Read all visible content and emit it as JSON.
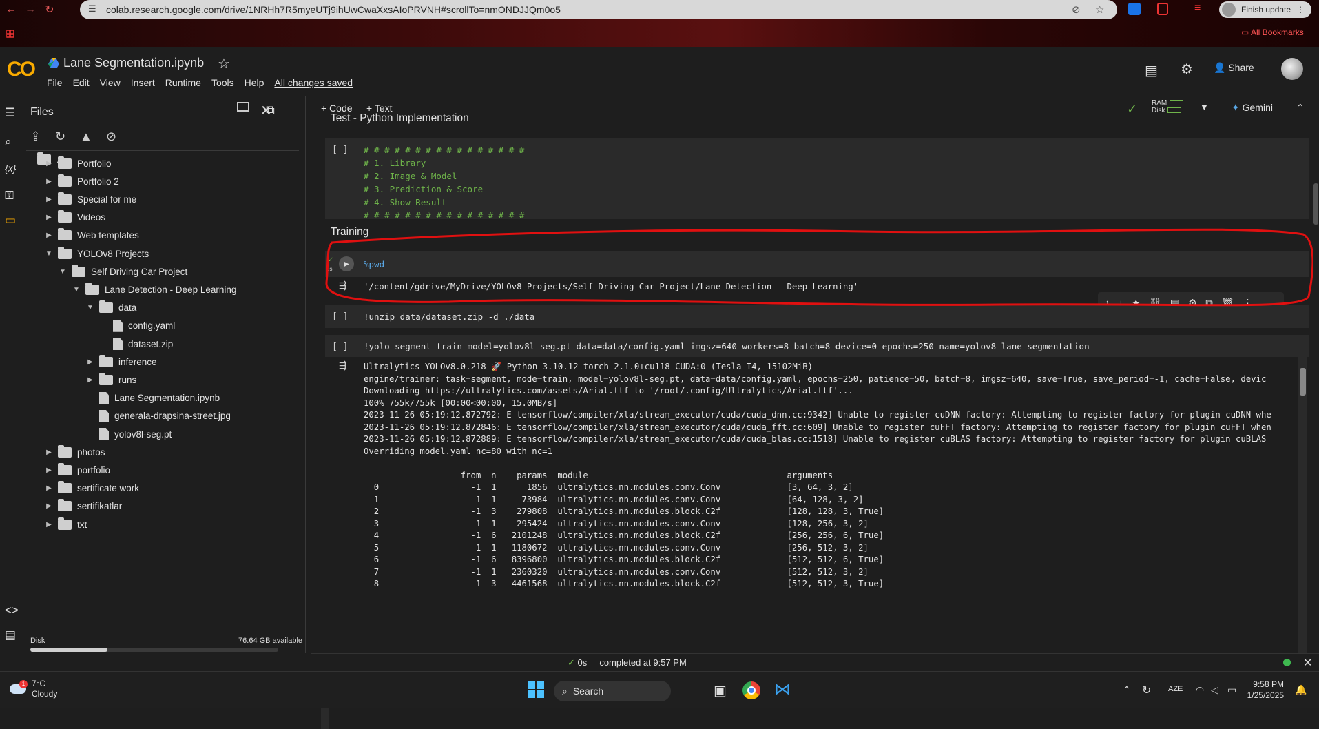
{
  "browser": {
    "url": "colab.research.google.com/drive/1NRHh7R5myeUTj9ihUwCwaXxsAIoPRVNH#scrollTo=nmONDJJQm0o5",
    "finish_update": "Finish update",
    "all_bookmarks": "All Bookmarks"
  },
  "header": {
    "logo": "CO",
    "notebook_name": "Lane Segmentation.ipynb",
    "menu": [
      "File",
      "Edit",
      "View",
      "Insert",
      "Runtime",
      "Tools",
      "Help"
    ],
    "saved_status": "All changes saved",
    "share_label": "Share"
  },
  "files_panel": {
    "title": "Files",
    "parent_dir": "..",
    "disk_label": "Disk",
    "disk_available": "76.64 GB available",
    "disk_used_fraction": 0.31,
    "tree": [
      {
        "label": "Portfolio",
        "type": "folder",
        "depth": 0,
        "expanded": false
      },
      {
        "label": "Portfolio 2",
        "type": "folder",
        "depth": 0,
        "expanded": false
      },
      {
        "label": "Special for me",
        "type": "folder",
        "depth": 0,
        "expanded": false
      },
      {
        "label": "Videos",
        "type": "folder",
        "depth": 0,
        "expanded": false
      },
      {
        "label": "Web templates",
        "type": "folder",
        "depth": 0,
        "expanded": false
      },
      {
        "label": "YOLOv8 Projects",
        "type": "folder",
        "depth": 0,
        "expanded": true
      },
      {
        "label": "Self Driving Car Project",
        "type": "folder",
        "depth": 1,
        "expanded": true
      },
      {
        "label": "Lane Detection - Deep Learning",
        "type": "folder",
        "depth": 2,
        "expanded": true
      },
      {
        "label": "data",
        "type": "folder",
        "depth": 3,
        "expanded": true
      },
      {
        "label": "config.yaml",
        "type": "file",
        "depth": 4
      },
      {
        "label": "dataset.zip",
        "type": "file",
        "depth": 4
      },
      {
        "label": "inference",
        "type": "folder",
        "depth": 3,
        "expanded": false
      },
      {
        "label": "runs",
        "type": "folder",
        "depth": 3,
        "expanded": false
      },
      {
        "label": "Lane Segmentation.ipynb",
        "type": "file",
        "depth": 3
      },
      {
        "label": "generala-drapsina-street.jpg",
        "type": "file",
        "depth": 3
      },
      {
        "label": "yolov8l-seg.pt",
        "type": "file",
        "depth": 3
      },
      {
        "label": "photos",
        "type": "folder",
        "depth": 0,
        "expanded": false
      },
      {
        "label": "portfolio",
        "type": "folder",
        "depth": 0,
        "expanded": false
      },
      {
        "label": "sertificate work",
        "type": "folder",
        "depth": 0,
        "expanded": false
      },
      {
        "label": "sertifikatlar",
        "type": "folder",
        "depth": 0,
        "expanded": false
      },
      {
        "label": "txt",
        "type": "folder",
        "depth": 0,
        "expanded": false
      }
    ]
  },
  "toolbar": {
    "code_btn": "+ Code",
    "text_btn": "+ Text",
    "ram_label": "RAM",
    "disk_label": "Disk",
    "gemini_label": "Gemini"
  },
  "cells": {
    "heading1": "Test - Python Implementation",
    "cell1_bracket": "[ ]",
    "cell1_lines": [
      "# # # # # # # # # # # # # # # #",
      "# 1. Library",
      "# 2. Image & Model",
      "# 3. Prediction & Score",
      "# 4. Show Result",
      "# # # # # # # # # # # # # # # #"
    ],
    "heading2": "Training",
    "cell2_exec_time": "0s",
    "cell2_code": "%pwd",
    "cell2_output": "'/content/gdrive/MyDrive/YOLOv8 Projects/Self Driving Car Project/Lane Detection - Deep Learning'",
    "cell3_bracket": "[ ]",
    "cell3_code": "!unzip data/dataset.zip -d ./data",
    "cell4_bracket": "[ ]",
    "cell4_code": "!yolo segment train model=yolov8l-seg.pt data=data/config.yaml imgsz=640 workers=8 batch=8 device=0 epochs=250 name=yolov8_lane_segmentation",
    "cell4_output": [
      "Ultralytics YOLOv8.0.218 🚀 Python-3.10.12 torch-2.1.0+cu118 CUDA:0 (Tesla T4, 15102MiB)",
      "engine/trainer: task=segment, mode=train, model=yolov8l-seg.pt, data=data/config.yaml, epochs=250, patience=50, batch=8, imgsz=640, save=True, save_period=-1, cache=False, devic",
      "Downloading https://ultralytics.com/assets/Arial.ttf to '/root/.config/Ultralytics/Arial.ttf'...",
      "100% 755k/755k [00:00<00:00, 15.0MB/s]",
      "2023-11-26 05:19:12.872792: E tensorflow/compiler/xla/stream_executor/cuda/cuda_dnn.cc:9342] Unable to register cuDNN factory: Attempting to register factory for plugin cuDNN whe",
      "2023-11-26 05:19:12.872846: E tensorflow/compiler/xla/stream_executor/cuda/cuda_fft.cc:609] Unable to register cuFFT factory: Attempting to register factory for plugin cuFFT when",
      "2023-11-26 05:19:12.872889: E tensorflow/compiler/xla/stream_executor/cuda/cuda_blas.cc:1518] Unable to register cuBLAS factory: Attempting to register factory for plugin cuBLAS",
      "Overriding model.yaml nc=80 with nc=1",
      "",
      "                   from  n    params  module                                       arguments",
      "  0                  -1  1      1856  ultralytics.nn.modules.conv.Conv             [3, 64, 3, 2]",
      "  1                  -1  1     73984  ultralytics.nn.modules.conv.Conv             [64, 128, 3, 2]",
      "  2                  -1  3    279808  ultralytics.nn.modules.block.C2f             [128, 128, 3, True]",
      "  3                  -1  1    295424  ultralytics.nn.modules.conv.Conv             [128, 256, 3, 2]",
      "  4                  -1  6   2101248  ultralytics.nn.modules.block.C2f             [256, 256, 6, True]",
      "  5                  -1  1   1180672  ultralytics.nn.modules.conv.Conv             [256, 512, 3, 2]",
      "  6                  -1  6   8396800  ultralytics.nn.modules.block.C2f             [512, 512, 6, True]",
      "  7                  -1  1   2360320  ultralytics.nn.modules.conv.Conv             [512, 512, 3, 2]",
      "  8                  -1  3   4461568  ultralytics.nn.modules.block.C2f             [512, 512, 3, True]"
    ]
  },
  "statusbar": {
    "time": "0s",
    "completed": "completed at 9:57 PM"
  },
  "taskbar": {
    "temp": "7°C",
    "weather": "Cloudy",
    "search": "Search",
    "lang": "AZE",
    "time": "9:58 PM",
    "date": "1/25/2025",
    "notif_count": "1"
  },
  "colors": {
    "accent_orange": "#f9ab00",
    "annotation_red": "#e01010",
    "code_green": "#6fb44a"
  }
}
